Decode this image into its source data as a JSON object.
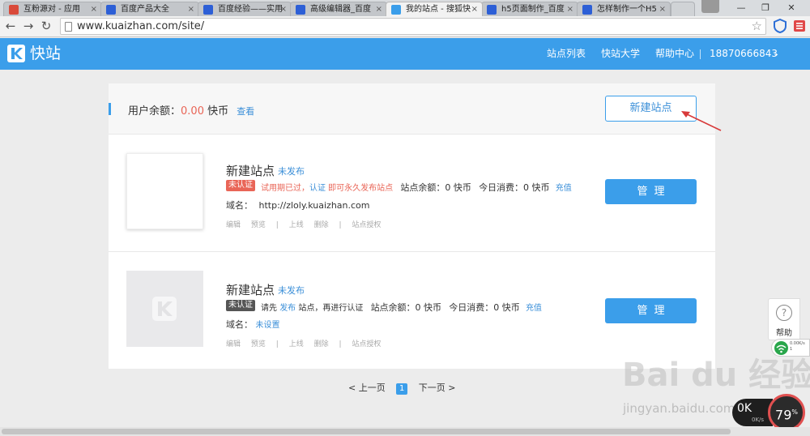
{
  "browser": {
    "tabs": [
      {
        "label": "互粉源对 - 应用",
        "icon_color": "#d94a3a",
        "active": false
      },
      {
        "label": "百度产品大全",
        "icon_color": "#2d5fd6",
        "active": false
      },
      {
        "label": "百度经验——实用",
        "icon_color": "#2d5fd6",
        "active": false
      },
      {
        "label": "高级编辑器_百度",
        "icon_color": "#2d5fd6",
        "active": false
      },
      {
        "label": "我的站点 - 搜狐快",
        "icon_color": "#3b9eea",
        "active": true
      },
      {
        "label": "h5页面制作_百度",
        "icon_color": "#2d5fd6",
        "active": false
      },
      {
        "label": "怎样制作一个H5",
        "icon_color": "#2d5fd6",
        "active": false
      }
    ],
    "url": "www.kuaizhan.com/site/",
    "tab_close_glyph": "×"
  },
  "header": {
    "logo_text": "快站",
    "nav": [
      "站点列表",
      "快站大学",
      "帮助中心"
    ],
    "user": "18870666843"
  },
  "balance": {
    "label": "用户余额：",
    "amount": "0.00",
    "unit": " 快币",
    "view_link": "查看"
  },
  "new_site_button": "新建站点",
  "sites": [
    {
      "name": "新建站点",
      "status": "未发布",
      "badge": "未认证",
      "info_red": "试用期已过，",
      "info_link": "认证",
      "info_red2": " 即可永久发布站点",
      "balance_text": "站点余额：0 快币",
      "today_text": "今日消费：0 快币",
      "recharge": "充值",
      "domain_label": "域名：",
      "domain_value": "http://zloly.kuaizhan.com",
      "actions": [
        "编辑",
        "预览",
        "|",
        "上线",
        "删除",
        "|",
        "站点授权"
      ],
      "manage": "管理"
    },
    {
      "name": "新建站点",
      "status": "未发布",
      "badge": "未认证",
      "info_pre": "请先 ",
      "info_link": "发布",
      "info_post": " 站点，再进行认证",
      "balance_text": "站点余额：0 快币",
      "today_text": "今日消费：0 快币",
      "recharge": "充值",
      "domain_label": "域名：",
      "domain_value": "未设置",
      "actions": [
        "编辑",
        "预览",
        "|",
        "上线",
        "删除",
        "|",
        "站点授权"
      ],
      "manage": "管理"
    }
  ],
  "pager": {
    "prev": "< 上一页",
    "current": "1",
    "next": "下一页 >"
  },
  "widgets": {
    "help_label": "帮助",
    "help_glyph": "?",
    "net_speed_1": "0.00K/s",
    "net_speed_2": "1",
    "speed_up": "0K",
    "speed_down": "0K/s",
    "gauge_value": "79",
    "gauge_unit": "%",
    "watermark": "Bai du 经验",
    "watermark_url": "jingyan.baidu.com"
  },
  "colors": {
    "brand": "#3b9eea",
    "alert": "#e96557",
    "link": "#3b8fd8"
  }
}
